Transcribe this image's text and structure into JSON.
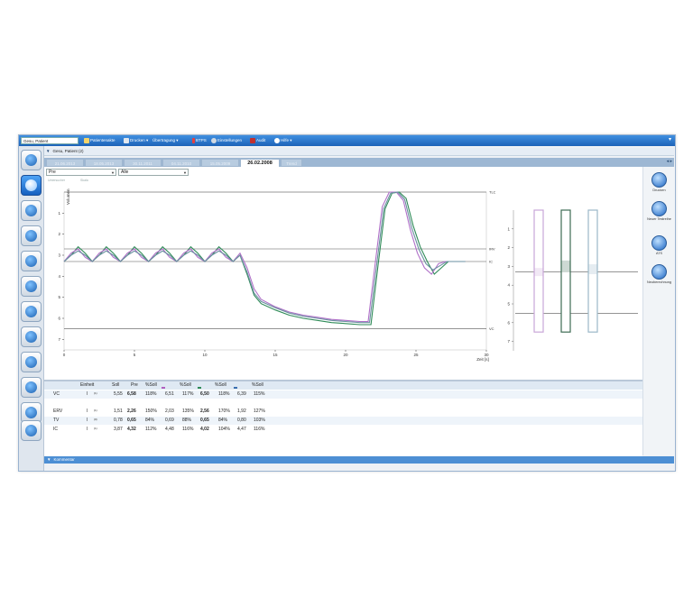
{
  "toolbar": {
    "patient": "Gesu, Patient",
    "items": [
      {
        "label": "Patientenakte"
      },
      {
        "label": "Drucken"
      },
      {
        "label": "Übertragung"
      },
      {
        "label": "BTPS"
      },
      {
        "label": "Einstellungen"
      },
      {
        "label": "Audit"
      },
      {
        "label": "Hilfe"
      }
    ]
  },
  "section": {
    "title": "Gesu, Patient (2)"
  },
  "tabs": [
    {
      "label": "21.06.2013"
    },
    {
      "label": "18.05.2013"
    },
    {
      "label": "30.11.2011"
    },
    {
      "label": "04.11.2010"
    },
    {
      "label": "15.05.2009"
    },
    {
      "label": "26.02.2008"
    },
    {
      "label": "Trend"
    }
  ],
  "filters": {
    "phase": "Pre",
    "scope": "Alle",
    "mini_labels": [
      "Untersucher",
      "Skala"
    ]
  },
  "chart_data": {
    "type": "line",
    "xlabel": "Zeit [s]",
    "ylabel": "Volumen",
    "xticks": [
      0,
      5,
      10,
      15,
      20,
      25,
      30
    ],
    "yticks": [
      1,
      2,
      3,
      4,
      5,
      6,
      7
    ],
    "xlim": [
      0,
      30
    ],
    "ylim": [
      0,
      7.5
    ],
    "reference_lines": [
      {
        "label": "TLC",
        "y": 0
      },
      {
        "label": "IRV",
        "y": 2.7
      },
      {
        "label": "IC",
        "y": 3.3
      },
      {
        "label": "VC",
        "y": 6.5
      }
    ],
    "series": [
      {
        "color": "#2e8b57",
        "x": [
          0,
          0.5,
          1,
          1.5,
          2,
          2.5,
          3,
          3.5,
          4,
          4.5,
          5,
          5.5,
          6,
          6.5,
          7,
          7.5,
          8,
          8.5,
          9,
          9.5,
          10,
          10.5,
          11,
          11.5,
          12,
          12.5,
          13,
          13.5,
          14,
          15,
          16,
          17,
          18,
          19,
          20,
          21,
          21.8,
          22.3,
          22.8,
          23.3,
          23.8,
          24.3,
          24.8,
          25.3,
          25.8,
          26.3,
          26.8,
          27.3,
          27.8,
          28.5
        ],
        "y": [
          3.3,
          3.0,
          2.6,
          2.9,
          3.3,
          3.0,
          2.6,
          2.9,
          3.3,
          3.0,
          2.6,
          2.9,
          3.3,
          3.0,
          2.6,
          2.9,
          3.3,
          3.0,
          2.6,
          2.9,
          3.3,
          3.0,
          2.6,
          2.9,
          3.3,
          3.0,
          3.9,
          4.9,
          5.3,
          5.6,
          5.85,
          6.0,
          6.1,
          6.2,
          6.25,
          6.3,
          6.3,
          3.5,
          0.8,
          0.05,
          0.0,
          0.3,
          1.6,
          2.6,
          3.3,
          3.9,
          3.6,
          3.3,
          3.3,
          3.3
        ]
      },
      {
        "color": "#b070c8",
        "x": [
          0,
          0.5,
          1,
          1.5,
          2,
          2.5,
          3,
          3.5,
          4,
          4.5,
          5,
          5.5,
          6,
          6.5,
          7,
          7.5,
          8,
          8.5,
          9,
          9.5,
          10,
          10.5,
          11,
          11.5,
          12,
          12.5,
          13,
          13.5,
          14,
          15,
          16,
          17,
          18,
          19,
          20,
          21,
          21.6,
          22.1,
          22.6,
          23.1,
          23.6,
          24.1,
          24.6,
          25.1,
          25.6,
          26.1,
          26.6,
          27.1,
          27.6,
          28.5
        ],
        "y": [
          3.3,
          2.9,
          2.7,
          3.1,
          3.3,
          2.9,
          2.7,
          3.1,
          3.3,
          2.9,
          2.7,
          3.1,
          3.3,
          2.9,
          2.7,
          3.1,
          3.3,
          2.9,
          2.7,
          3.1,
          3.3,
          2.9,
          2.7,
          3.1,
          3.3,
          2.9,
          3.6,
          4.6,
          5.1,
          5.45,
          5.7,
          5.85,
          5.95,
          6.05,
          6.1,
          6.15,
          6.15,
          3.4,
          0.7,
          0.0,
          0.0,
          0.4,
          1.8,
          2.9,
          3.6,
          3.9,
          3.4,
          3.3,
          3.3,
          3.3
        ]
      },
      {
        "color": "#6a8fa0",
        "x": [
          0,
          0.5,
          1,
          1.5,
          2,
          2.5,
          3,
          3.5,
          4,
          4.5,
          5,
          5.5,
          6,
          6.5,
          7,
          7.5,
          8,
          8.5,
          9,
          9.5,
          10,
          10.5,
          11,
          11.5,
          12,
          12.5,
          13,
          13.5,
          14,
          15,
          16,
          17,
          18,
          19,
          20,
          21,
          21.7,
          22.2,
          22.7,
          23.2,
          23.7,
          24.2,
          24.7,
          25.2,
          25.7,
          26.2,
          26.7,
          27.2,
          27.7,
          28.5
        ],
        "y": [
          3.3,
          3.0,
          2.8,
          3.0,
          3.3,
          3.0,
          2.8,
          3.0,
          3.3,
          3.0,
          2.8,
          3.0,
          3.3,
          3.0,
          2.8,
          3.0,
          3.3,
          3.0,
          2.8,
          3.0,
          3.3,
          3.0,
          2.8,
          3.0,
          3.3,
          3.0,
          3.8,
          4.8,
          5.2,
          5.5,
          5.75,
          5.9,
          6.0,
          6.1,
          6.15,
          6.2,
          6.2,
          3.5,
          0.8,
          0.05,
          0.0,
          0.35,
          1.7,
          2.7,
          3.4,
          3.7,
          3.5,
          3.3,
          3.3,
          3.3
        ]
      }
    ]
  },
  "bars_chart": {
    "yticks": [
      1,
      2,
      3,
      4,
      5,
      6,
      7
    ],
    "bars": [
      {
        "color": "#c9a6d8",
        "top": 0,
        "bottom": 6.5,
        "mid_low": 3.5,
        "mid_high": 3.1
      },
      {
        "color": "#3e6b54",
        "top": 0,
        "bottom": 6.5,
        "mid_low": 3.3,
        "mid_high": 2.7
      },
      {
        "color": "#9bb8c8",
        "top": 0,
        "bottom": 6.5,
        "mid_low": 3.4,
        "mid_high": 2.9
      }
    ],
    "ref_lines": [
      3.3,
      5.5
    ]
  },
  "table": {
    "headers": [
      "Einheit",
      "Soll",
      "Pre",
      "%Soll",
      "",
      "%Soll",
      "",
      "%Soll",
      "",
      "%Soll"
    ],
    "rows": [
      {
        "name": "VC",
        "unit": "l",
        "sup": "(1)",
        "soll": "5,55",
        "pre": "6,58",
        "pct": "118%",
        "c1": "6,51",
        "p1": "117%",
        "c2": "6,50",
        "p2": "118%",
        "c3": "6,39",
        "p3": "115%"
      },
      {
        "name": "ERV",
        "unit": "l",
        "sup": "(1)",
        "soll": "1,51",
        "pre": "2,26",
        "pct": "150%",
        "c1": "2,03",
        "p1": "135%",
        "c2": "2,56",
        "p2": "170%",
        "c3": "1,92",
        "p3": "127%"
      },
      {
        "name": "TV",
        "unit": "l",
        "sup": "(0)",
        "soll": "0,78",
        "pre": "0,65",
        "pct": "84%",
        "c1": "0,69",
        "p1": "88%",
        "c2": "0,65",
        "p2": "84%",
        "c3": "0,80",
        "p3": "103%"
      },
      {
        "name": "IC",
        "unit": "l",
        "sup": "(1)",
        "soll": "3,87",
        "pre": "4,32",
        "pct": "112%",
        "c1": "4,48",
        "p1": "116%",
        "c2": "4,02",
        "p2": "104%",
        "c3": "4,47",
        "p3": "116%"
      }
    ],
    "swatches": [
      "#b060c0",
      "#2e8b57",
      "#3a6fb0"
    ]
  },
  "rightbar": [
    {
      "label": "Drucken"
    },
    {
      "label": "Neuer Testreihe"
    },
    {
      "label": "ATS"
    },
    {
      "label": "Neuberechnung"
    }
  ],
  "bottom": {
    "label": "Kommentar"
  }
}
